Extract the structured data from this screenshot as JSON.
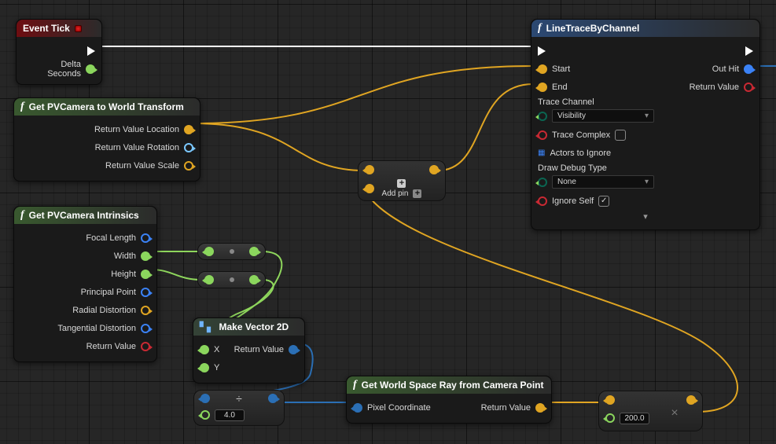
{
  "nodes": {
    "eventTick": {
      "title": "Event Tick",
      "outputs": {
        "delta": "Delta Seconds"
      }
    },
    "camTransform": {
      "title": "Get PVCamera to World Transform",
      "outputs": {
        "loc": "Return Value Location",
        "rot": "Return Value Rotation",
        "scale": "Return Value Scale"
      }
    },
    "intrinsics": {
      "title": "Get PVCamera Intrinsics",
      "outputs": {
        "focal": "Focal Length",
        "width": "Width",
        "height": "Height",
        "pp": "Principal Point",
        "rd": "Radial Distortion",
        "td": "Tangential Distortion",
        "rv": "Return Value"
      }
    },
    "makeVec": {
      "title": "Make Vector 2D",
      "inputs": {
        "x": "X",
        "y": "Y"
      },
      "outputs": {
        "rv": "Return Value"
      }
    },
    "divide": {
      "op": "÷",
      "value": "4.0"
    },
    "worldRay": {
      "title": "Get World Space Ray from Camera Point",
      "inputs": {
        "pc": "Pixel Coordinate"
      },
      "outputs": {
        "rv": "Return Value"
      }
    },
    "mult": {
      "op": "x",
      "value": "200.0"
    },
    "addPin": {
      "label": "Add pin"
    },
    "lineTrace": {
      "title": "LineTraceByChannel",
      "inputs": {
        "start": "Start",
        "end": "End",
        "tc": "Trace Channel",
        "complex": "Trace Complex",
        "ignore": "Actors to Ignore",
        "ddt": "Draw Debug Type",
        "self": "Ignore Self"
      },
      "outputs": {
        "hit": "Out Hit",
        "rv": "Return Value"
      },
      "tcValue": "Visibility",
      "ddtValue": "None",
      "selfChecked": "✓"
    }
  },
  "chart_data": {
    "type": "node-graph",
    "engine": "Unreal Engine Blueprint",
    "nodes": [
      "Event Tick",
      "Get PVCamera to World Transform",
      "Get PVCamera Intrinsics",
      "Make Vector 2D",
      "Divide (÷)",
      "Get World Space Ray from Camera Point",
      "Multiply (x)",
      "Add (struct)",
      "LineTraceByChannel"
    ],
    "edges": [
      {
        "from": "Event Tick.exec",
        "to": "LineTraceByChannel.exec",
        "kind": "exec"
      },
      {
        "from": "Get PVCamera to World Transform.Return Value Location",
        "to": "Add.A",
        "kind": "vector"
      },
      {
        "from": "Get PVCamera to World Transform.Return Value Location",
        "to": "LineTraceByChannel.Start",
        "kind": "vector"
      },
      {
        "from": "Get PVCamera Intrinsics.Width",
        "to": "Float→.A",
        "kind": "float"
      },
      {
        "from": "Get PVCamera Intrinsics.Height",
        "to": "Float→.A2",
        "kind": "float"
      },
      {
        "from": "Float→.out",
        "to": "Make Vector 2D.X",
        "kind": "float"
      },
      {
        "from": "Float→.out2",
        "to": "Make Vector 2D.Y",
        "kind": "float"
      },
      {
        "from": "Make Vector 2D.Return Value",
        "to": "Divide.A",
        "kind": "vector2d"
      },
      {
        "from": "Divide.out",
        "to": "Get World Space Ray from Camera Point.Pixel Coordinate",
        "kind": "vector2d"
      },
      {
        "from": "Get World Space Ray from Camera Point.Return Value",
        "to": "Multiply.A",
        "kind": "vector"
      },
      {
        "from": "Multiply.out",
        "to": "Add.B",
        "kind": "vector"
      },
      {
        "from": "Add.out",
        "to": "LineTraceByChannel.End",
        "kind": "vector"
      }
    ],
    "constants": {
      "Divide.B": 4.0,
      "Multiply.B": 200.0
    }
  }
}
